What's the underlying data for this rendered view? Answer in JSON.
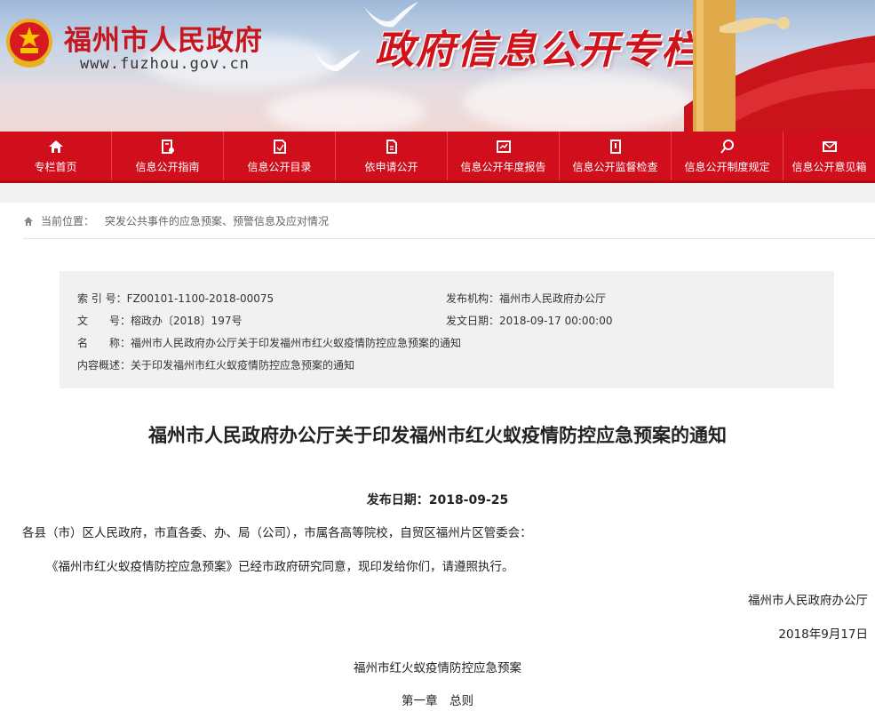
{
  "header": {
    "site_name": "福州市人民政府",
    "site_url": "www.fuzhou.gov.cn",
    "column_title": "政府信息公开专栏"
  },
  "nav": {
    "items": [
      {
        "label": "专栏首页",
        "icon": "home-icon"
      },
      {
        "label": "信息公开指南",
        "icon": "guide-icon"
      },
      {
        "label": "信息公开目录",
        "icon": "catalog-icon"
      },
      {
        "label": "依申请公开",
        "icon": "document-icon"
      },
      {
        "label": "信息公开年度报告",
        "icon": "report-icon"
      },
      {
        "label": "信息公开监督检查",
        "icon": "inspection-icon"
      },
      {
        "label": "信息公开制度规定",
        "icon": "regulation-icon"
      },
      {
        "label": "信息公开意见箱",
        "icon": "mailbox-icon"
      }
    ]
  },
  "breadcrumb": {
    "prefix": "当前位置：",
    "current": "突发公共事件的应急预案、预警信息及应对情况"
  },
  "meta": {
    "index_label": "索 引 号：",
    "index_value": "FZ00101-1100-2018-00075",
    "issuer_label": "发布机构：",
    "issuer_value": "福州市人民政府办公厅",
    "docno_label": "文　　号：",
    "docno_value": "榕政办〔2018〕197号",
    "date_label": "发文日期：",
    "date_value": "2018-09-17 00:00:00",
    "name_label": "名　　称：",
    "name_value": "福州市人民政府办公厅关于印发福州市红火蚁疫情防控应急预案的通知",
    "summary_label": "内容概述：",
    "summary_value": "关于印发福州市红火蚁疫情防控应急预案的通知"
  },
  "article": {
    "title": "福州市人民政府办公厅关于印发福州市红火蚁疫情防控应急预案的通知",
    "pub_date": "发布日期：2018-09-25",
    "recipients": "各县（市）区人民政府，市直各委、办、局（公司），市属各高等院校，自贸区福州片区管委会：",
    "body": "《福州市红火蚁疫情防控应急预案》已经市政府研究同意，现印发给你们，请遵照执行。",
    "signature": "福州市人民政府办公厅",
    "sign_date": "2018年9月17日",
    "plan_title": "福州市红火蚁疫情防控应急预案",
    "chapter": "第一章　总则"
  },
  "colors": {
    "brand_red": "#d10e1b",
    "meta_bg": "#f1f1f1"
  }
}
